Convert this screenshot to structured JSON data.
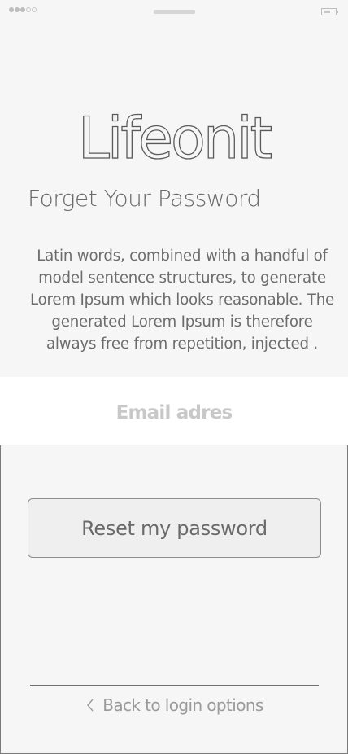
{
  "status_bar": {
    "signal_icon": "signal-dots-icon",
    "battery_icon": "battery-icon"
  },
  "header": {
    "logo_text": "Lifeonit",
    "title": "Forget Your Password",
    "description": "Latin words, combined with a handful of model sentence structures, to generate Lorem Ipsum which looks reasonable. The generated Lorem Ipsum is therefore always free from repetition, injected ."
  },
  "form": {
    "email_placeholder": "Email adres",
    "email_value": ""
  },
  "actions": {
    "reset_label": "Reset my password",
    "back_label": "Back to login options",
    "back_icon": "chevron-left-icon"
  }
}
